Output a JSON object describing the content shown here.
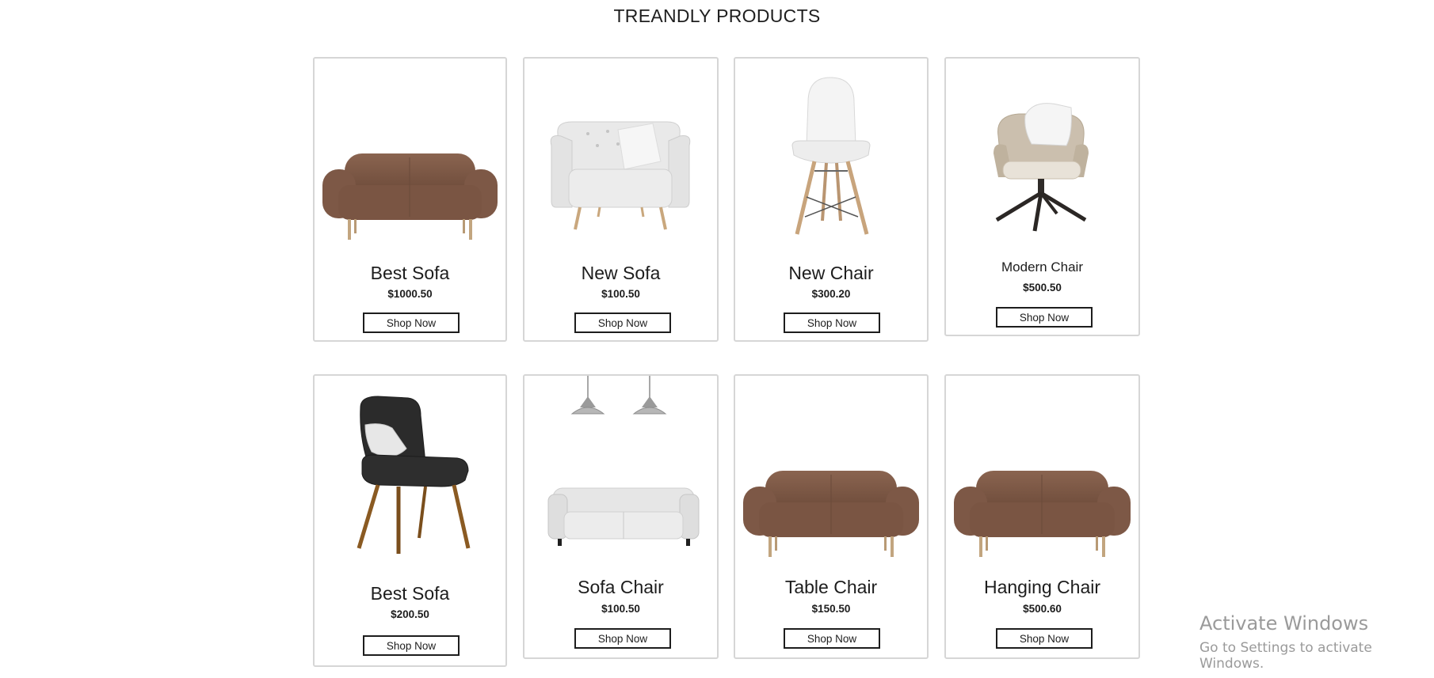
{
  "section": {
    "title": "TREANDLY PRODUCTS"
  },
  "products": [
    {
      "name": "Best Sofa",
      "price": "$1000.50",
      "button": "Shop Now",
      "image": "brown-sofa"
    },
    {
      "name": "New Sofa",
      "price": "$100.50",
      "button": "Shop Now",
      "image": "white-armchair"
    },
    {
      "name": "New Chair",
      "price": "$300.20",
      "button": "Shop Now",
      "image": "white-eames-chair"
    },
    {
      "name": "Modern Chair",
      "price": "$500.50",
      "button": "Shop Now",
      "image": "beige-swivel-chair"
    },
    {
      "name": "Best Sofa",
      "price": "$200.50",
      "button": "Shop Now",
      "image": "black-dining-chair"
    },
    {
      "name": "Sofa Chair",
      "price": "$100.50",
      "button": "Shop Now",
      "image": "white-sofa-with-lamps"
    },
    {
      "name": "Table Chair",
      "price": "$150.50",
      "button": "Shop Now",
      "image": "brown-sofa"
    },
    {
      "name": "Hanging Chair",
      "price": "$500.60",
      "button": "Shop Now",
      "image": "brown-sofa"
    }
  ],
  "watermark": {
    "title": "Activate Windows",
    "subtitle": "Go to Settings to activate Windows."
  },
  "colors": {
    "card_border": "#d6d6d6",
    "button_border": "#1d1d1d",
    "sofa_brown": "#7a5543",
    "watermark": "#9a9a9a"
  }
}
